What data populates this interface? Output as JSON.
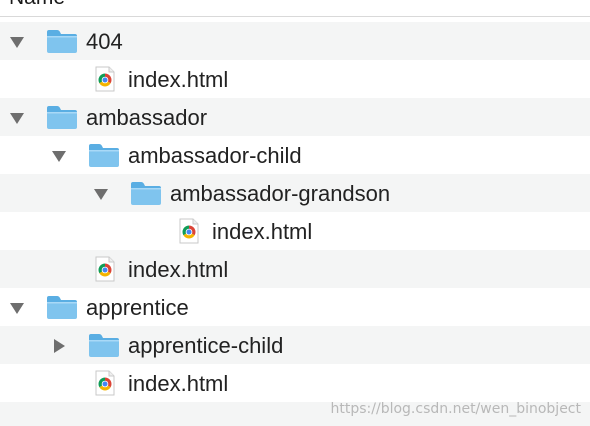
{
  "header": {
    "name_column": "Name"
  },
  "watermark": "https://blog.csdn.net/wen_binobject",
  "icons": {
    "folder": "folder-icon",
    "html_file": "chrome-html-file-icon",
    "expanded": "disclosure-expanded-icon",
    "collapsed": "disclosure-collapsed-icon"
  },
  "colors": {
    "folder": "#7fc4ee",
    "row_shade": "#f4f5f5",
    "disclosure": "#6e6e6e"
  },
  "tree": [
    {
      "label": "404",
      "kind": "folder",
      "depth": 0,
      "disclosure": "expanded"
    },
    {
      "label": "index.html",
      "kind": "file",
      "depth": 1,
      "disclosure": "none"
    },
    {
      "label": "ambassador",
      "kind": "folder",
      "depth": 0,
      "disclosure": "expanded"
    },
    {
      "label": "ambassador-child",
      "kind": "folder",
      "depth": 1,
      "disclosure": "expanded"
    },
    {
      "label": "ambassador-grandson",
      "kind": "folder",
      "depth": 2,
      "disclosure": "expanded"
    },
    {
      "label": "index.html",
      "kind": "file",
      "depth": 3,
      "disclosure": "none"
    },
    {
      "label": "index.html",
      "kind": "file",
      "depth": 1,
      "disclosure": "none"
    },
    {
      "label": "apprentice",
      "kind": "folder",
      "depth": 0,
      "disclosure": "expanded"
    },
    {
      "label": "apprentice-child",
      "kind": "folder",
      "depth": 1,
      "disclosure": "collapsed"
    },
    {
      "label": "index.html",
      "kind": "file",
      "depth": 1,
      "disclosure": "none"
    }
  ]
}
